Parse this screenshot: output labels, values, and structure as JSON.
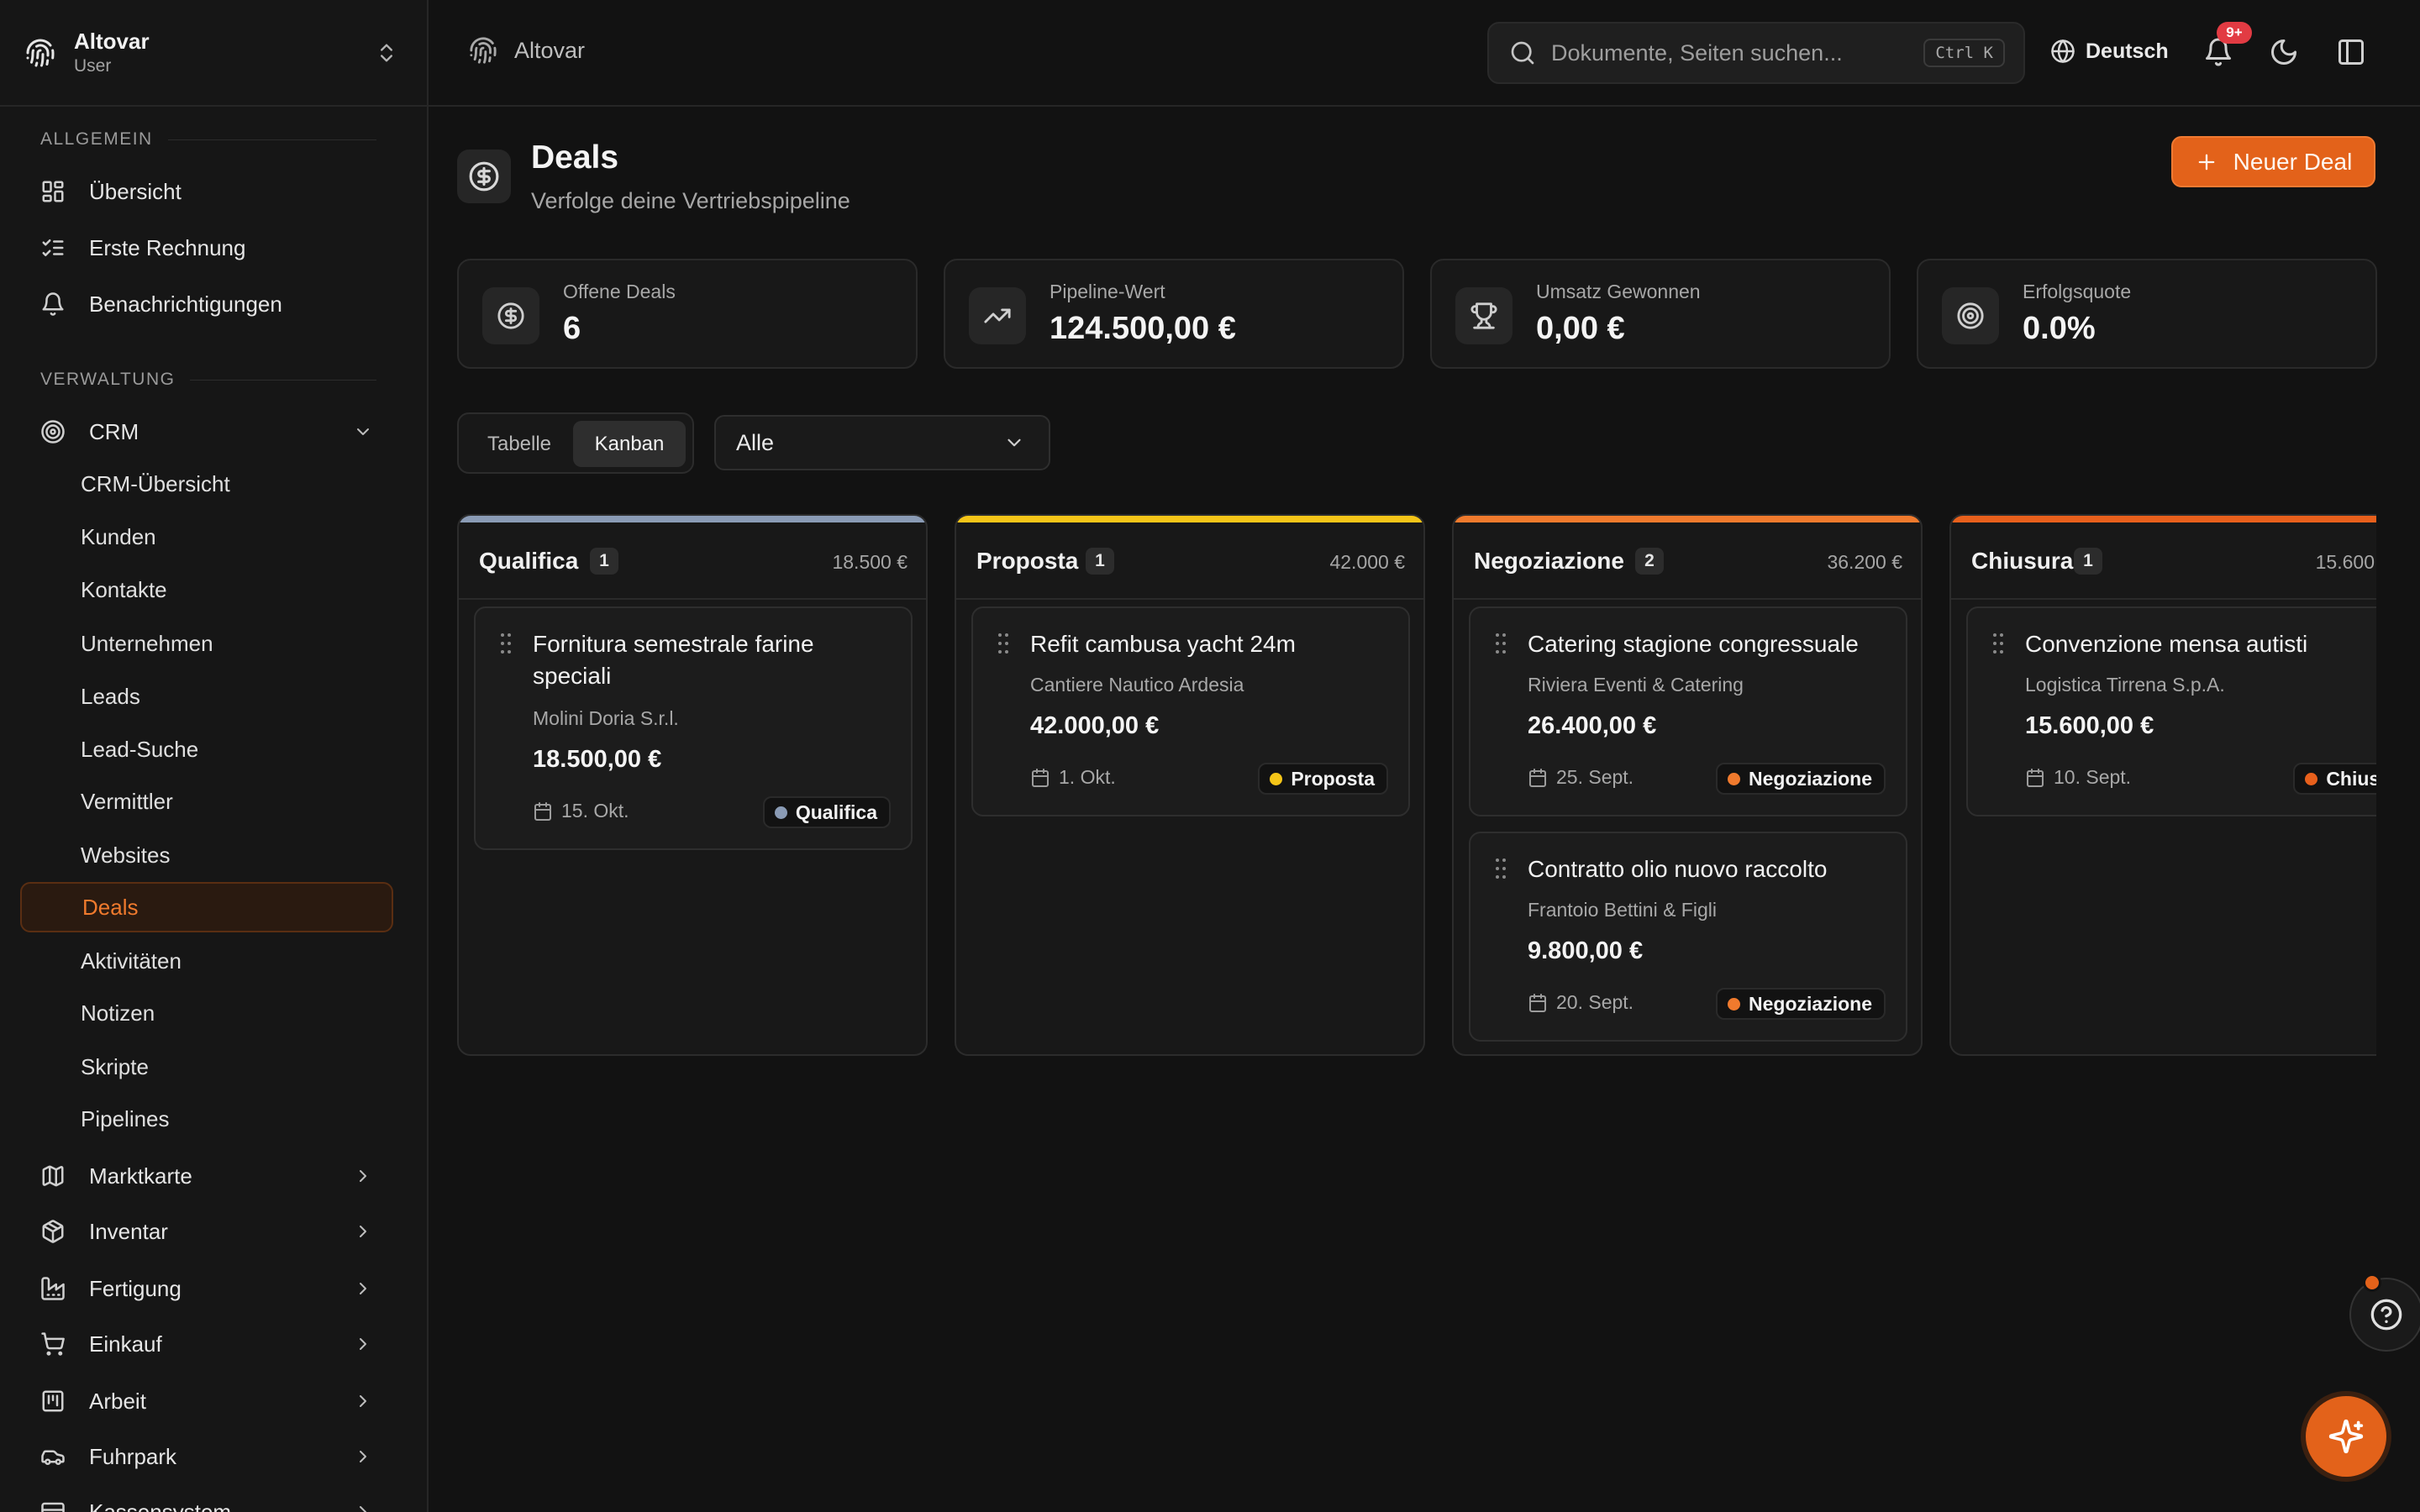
{
  "sidebar": {
    "app_name": "Altovar",
    "user_role": "User",
    "sections": {
      "general": "Allgemein",
      "admin": "Verwaltung"
    },
    "general_items": [
      "Übersicht",
      "Erste Rechnung",
      "Benachrichtigungen"
    ],
    "crm_label": "CRM",
    "crm_items": [
      "CRM-Übersicht",
      "Kunden",
      "Kontakte",
      "Unternehmen",
      "Leads",
      "Lead-Suche",
      "Vermittler",
      "Websites",
      "Deals",
      "Aktivitäten",
      "Notizen",
      "Skripte",
      "Pipelines"
    ],
    "active_item": "Deals",
    "modules": [
      "Marktkarte",
      "Inventar",
      "Fertigung",
      "Einkauf",
      "Arbeit",
      "Fuhrpark",
      "Kassensystem"
    ]
  },
  "header": {
    "breadcrumb": "Altovar",
    "search_placeholder": "Dokumente, Seiten suchen...",
    "search_shortcut": "Ctrl K",
    "language": "Deutsch",
    "notification_badge": "9+"
  },
  "page": {
    "title": "Deals",
    "subtitle": "Verfolge deine Vertriebspipeline",
    "new_button": "Neuer Deal"
  },
  "stats": [
    {
      "label": "Offene Deals",
      "value": "6",
      "icon": "dollar-circle-icon"
    },
    {
      "label": "Pipeline-Wert",
      "value": "124.500,00 €",
      "icon": "trending-up-icon"
    },
    {
      "label": "Umsatz Gewonnen",
      "value": "0,00 €",
      "icon": "trophy-icon"
    },
    {
      "label": "Erfolgsquote",
      "value": "0.0%",
      "icon": "target-icon"
    }
  ],
  "view": {
    "table_label": "Tabelle",
    "kanban_label": "Kanban",
    "active": "Kanban",
    "filter_value": "Alle"
  },
  "colors": {
    "accent": "#e3621a",
    "qualifica": "#8a9bb5",
    "proposta": "#f5c518",
    "negoziazione": "#f07a2d",
    "chiusura": "#e8601c"
  },
  "columns": [
    {
      "name": "Qualifica",
      "count": "1",
      "sum": "18.500 €",
      "cards": [
        {
          "title": "Fornitura semestrale farine speciali",
          "company": "Molini Doria S.r.l.",
          "amount": "18.500,00 €",
          "date": "15. Okt.",
          "stage": "Qualifica"
        }
      ]
    },
    {
      "name": "Proposta",
      "count": "1",
      "sum": "42.000 €",
      "cards": [
        {
          "title": "Refit cambusa yacht 24m",
          "company": "Cantiere Nautico Ardesia",
          "amount": "42.000,00 €",
          "date": "1. Okt.",
          "stage": "Proposta"
        }
      ]
    },
    {
      "name": "Negoziazione",
      "count": "2",
      "sum": "36.200 €",
      "cards": [
        {
          "title": "Catering stagione congressuale",
          "company": "Riviera Eventi & Catering",
          "amount": "26.400,00 €",
          "date": "25. Sept.",
          "stage": "Negoziazione"
        },
        {
          "title": "Contratto olio nuovo raccolto",
          "company": "Frantoio Bettini & Figli",
          "amount": "9.800,00 €",
          "date": "20. Sept.",
          "stage": "Negoziazione"
        }
      ]
    },
    {
      "name": "Chiusura",
      "count": "1",
      "sum": "15.600",
      "cards": [
        {
          "title": "Convenzione mensa autisti",
          "company": "Logistica Tirrena S.p.A.",
          "amount": "15.600,00 €",
          "date": "10. Sept.",
          "stage": "Chiusura"
        }
      ]
    }
  ]
}
